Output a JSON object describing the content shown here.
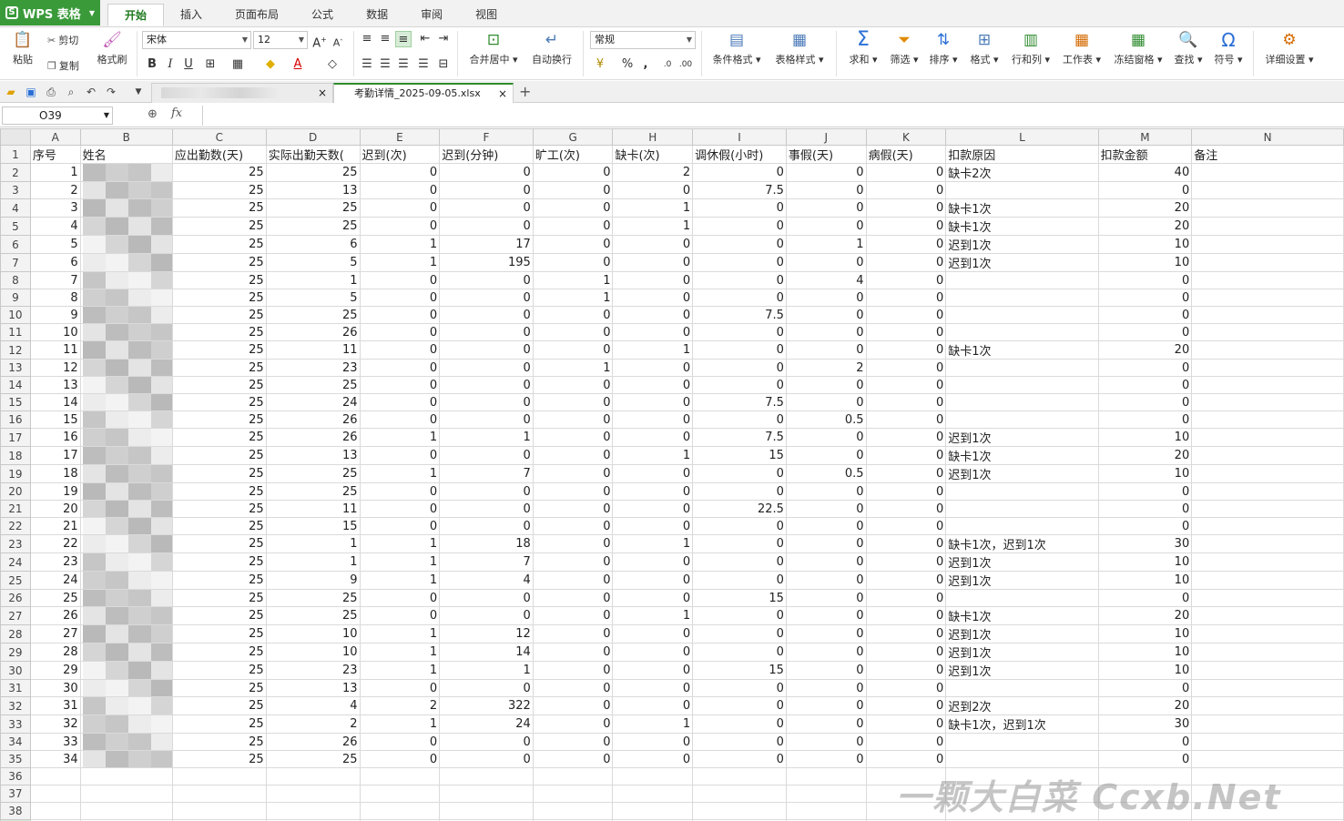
{
  "app": {
    "title": "WPS 表格"
  },
  "menu": {
    "tabs": [
      "开始",
      "插入",
      "页面布局",
      "公式",
      "数据",
      "审阅",
      "视图"
    ],
    "active": "开始"
  },
  "ribbon": {
    "paste": "粘贴",
    "cut": "剪切",
    "copy": "复制",
    "format_painter": "格式刷",
    "font_name": "宋体",
    "font_size": "12",
    "bold": "B",
    "italic": "I",
    "underline": "U",
    "font_color_letter": "A",
    "merge_center": "合并居中",
    "wrap": "自动换行",
    "number_format": "常规",
    "percent": "%",
    "comma": ",",
    "cond_format": "条件格式",
    "table_style": "表格样式",
    "sum": "求和",
    "filter": "筛选",
    "sort": "排序",
    "format": "格式",
    "row_col": "行和列",
    "worksheet": "工作表",
    "freeze": "冻结窗格",
    "find": "查找",
    "symbol": "符号",
    "settings": "详细设置"
  },
  "doc_tabs": {
    "active_file": "考勤详情_2025-09-05.xlsx"
  },
  "formula_bar": {
    "cell_ref": "O39",
    "fx": "fx",
    "value": ""
  },
  "columns": [
    "A",
    "B",
    "C",
    "D",
    "E",
    "F",
    "G",
    "H",
    "I",
    "J",
    "K",
    "L",
    "M",
    "N"
  ],
  "headers": [
    "序号",
    "姓名",
    "应出勤数(天)",
    "实际出勤天数(",
    "迟到(次)",
    "迟到(分钟)",
    "旷工(次)",
    "缺卡(次)",
    "调休假(小时)",
    "事假(天)",
    "病假(天)",
    "扣款原因",
    "扣款金额",
    "备注"
  ],
  "rows": [
    [
      "1",
      "",
      "25",
      "25",
      "0",
      "0",
      "0",
      "2",
      "0",
      "0",
      "0",
      "缺卡2次",
      "40",
      ""
    ],
    [
      "2",
      "",
      "25",
      "13",
      "0",
      "0",
      "0",
      "0",
      "7.5",
      "0",
      "0",
      "",
      "0",
      ""
    ],
    [
      "3",
      "",
      "25",
      "25",
      "0",
      "0",
      "0",
      "1",
      "0",
      "0",
      "0",
      "缺卡1次",
      "20",
      ""
    ],
    [
      "4",
      "",
      "25",
      "25",
      "0",
      "0",
      "0",
      "1",
      "0",
      "0",
      "0",
      "缺卡1次",
      "20",
      ""
    ],
    [
      "5",
      "",
      "25",
      "6",
      "1",
      "17",
      "0",
      "0",
      "0",
      "1",
      "0",
      "迟到1次",
      "10",
      ""
    ],
    [
      "6",
      "",
      "25",
      "5",
      "1",
      "195",
      "0",
      "0",
      "0",
      "0",
      "0",
      "迟到1次",
      "10",
      ""
    ],
    [
      "7",
      "",
      "25",
      "1",
      "0",
      "0",
      "1",
      "0",
      "0",
      "4",
      "0",
      "",
      "0",
      ""
    ],
    [
      "8",
      "",
      "25",
      "5",
      "0",
      "0",
      "1",
      "0",
      "0",
      "0",
      "0",
      "",
      "0",
      ""
    ],
    [
      "9",
      "",
      "25",
      "25",
      "0",
      "0",
      "0",
      "0",
      "7.5",
      "0",
      "0",
      "",
      "0",
      ""
    ],
    [
      "10",
      "",
      "25",
      "26",
      "0",
      "0",
      "0",
      "0",
      "0",
      "0",
      "0",
      "",
      "0",
      ""
    ],
    [
      "11",
      "",
      "25",
      "11",
      "0",
      "0",
      "0",
      "1",
      "0",
      "0",
      "0",
      "缺卡1次",
      "20",
      ""
    ],
    [
      "12",
      "",
      "25",
      "23",
      "0",
      "0",
      "1",
      "0",
      "0",
      "2",
      "0",
      "",
      "0",
      ""
    ],
    [
      "13",
      "",
      "25",
      "25",
      "0",
      "0",
      "0",
      "0",
      "0",
      "0",
      "0",
      "",
      "0",
      ""
    ],
    [
      "14",
      "",
      "25",
      "24",
      "0",
      "0",
      "0",
      "0",
      "7.5",
      "0",
      "0",
      "",
      "0",
      ""
    ],
    [
      "15",
      "",
      "25",
      "26",
      "0",
      "0",
      "0",
      "0",
      "0",
      "0.5",
      "0",
      "",
      "0",
      ""
    ],
    [
      "16",
      "",
      "25",
      "26",
      "1",
      "1",
      "0",
      "0",
      "7.5",
      "0",
      "0",
      "迟到1次",
      "10",
      ""
    ],
    [
      "17",
      "",
      "25",
      "13",
      "0",
      "0",
      "0",
      "1",
      "15",
      "0",
      "0",
      "缺卡1次",
      "20",
      ""
    ],
    [
      "18",
      "",
      "25",
      "25",
      "1",
      "7",
      "0",
      "0",
      "0",
      "0.5",
      "0",
      "迟到1次",
      "10",
      ""
    ],
    [
      "19",
      "",
      "25",
      "25",
      "0",
      "0",
      "0",
      "0",
      "0",
      "0",
      "0",
      "",
      "0",
      ""
    ],
    [
      "20",
      "",
      "25",
      "11",
      "0",
      "0",
      "0",
      "0",
      "22.5",
      "0",
      "0",
      "",
      "0",
      ""
    ],
    [
      "21",
      "",
      "25",
      "15",
      "0",
      "0",
      "0",
      "0",
      "0",
      "0",
      "0",
      "",
      "0",
      ""
    ],
    [
      "22",
      "",
      "25",
      "1",
      "1",
      "18",
      "0",
      "1",
      "0",
      "0",
      "0",
      "缺卡1次，迟到1次",
      "30",
      ""
    ],
    [
      "23",
      "",
      "25",
      "1",
      "1",
      "7",
      "0",
      "0",
      "0",
      "0",
      "0",
      "迟到1次",
      "10",
      ""
    ],
    [
      "24",
      "",
      "25",
      "9",
      "1",
      "4",
      "0",
      "0",
      "0",
      "0",
      "0",
      "迟到1次",
      "10",
      ""
    ],
    [
      "25",
      "",
      "25",
      "25",
      "0",
      "0",
      "0",
      "0",
      "15",
      "0",
      "0",
      "",
      "0",
      ""
    ],
    [
      "26",
      "",
      "25",
      "25",
      "0",
      "0",
      "0",
      "1",
      "0",
      "0",
      "0",
      "缺卡1次",
      "20",
      ""
    ],
    [
      "27",
      "",
      "25",
      "10",
      "1",
      "12",
      "0",
      "0",
      "0",
      "0",
      "0",
      "迟到1次",
      "10",
      ""
    ],
    [
      "28",
      "",
      "25",
      "10",
      "1",
      "14",
      "0",
      "0",
      "0",
      "0",
      "0",
      "迟到1次",
      "10",
      ""
    ],
    [
      "29",
      "",
      "25",
      "23",
      "1",
      "1",
      "0",
      "0",
      "15",
      "0",
      "0",
      "迟到1次",
      "10",
      ""
    ],
    [
      "30",
      "",
      "25",
      "13",
      "0",
      "0",
      "0",
      "0",
      "0",
      "0",
      "0",
      "",
      "0",
      ""
    ],
    [
      "31",
      "",
      "25",
      "4",
      "2",
      "322",
      "0",
      "0",
      "0",
      "0",
      "0",
      "迟到2次",
      "20",
      ""
    ],
    [
      "32",
      "",
      "25",
      "2",
      "1",
      "24",
      "0",
      "1",
      "0",
      "0",
      "0",
      "缺卡1次，迟到1次",
      "30",
      ""
    ],
    [
      "33",
      "",
      "25",
      "26",
      "0",
      "0",
      "0",
      "0",
      "0",
      "0",
      "0",
      "",
      "0",
      ""
    ],
    [
      "34",
      "",
      "25",
      "25",
      "0",
      "0",
      "0",
      "0",
      "0",
      "0",
      "0",
      "",
      "0",
      ""
    ]
  ],
  "empty_rows": [
    36,
    37,
    38,
    39
  ],
  "selected_row": 39,
  "watermark": "一颗大白菜 Ccxb.Net"
}
